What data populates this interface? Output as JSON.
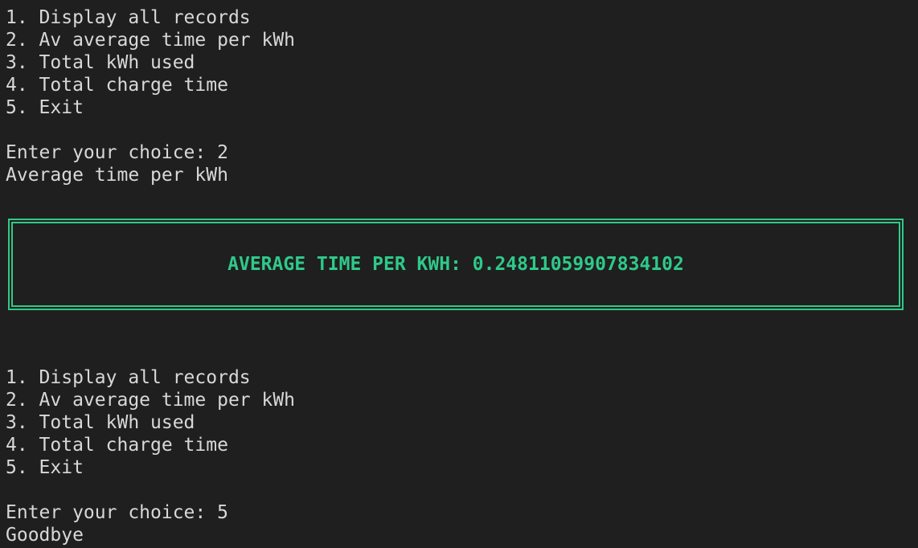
{
  "session1": {
    "menu": [
      "1. Display all records",
      "2. Av average time per kWh",
      "3. Total kWh used",
      "4. Total charge time",
      "5. Exit"
    ],
    "prompt": "Enter your choice: 2",
    "response": "Average time per kWh"
  },
  "result": {
    "text": "AVERAGE TIME PER KWH: 0.24811059907834102",
    "color": "#2fc98a"
  },
  "session2": {
    "menu": [
      "1. Display all records",
      "2. Av average time per kWh",
      "3. Total kWh used",
      "4. Total charge time",
      "5. Exit"
    ],
    "prompt": "Enter your choice: 5",
    "response": "Goodbye"
  },
  "theme": {
    "background": "#1f1f1f",
    "foreground": "#d8d8d8"
  }
}
